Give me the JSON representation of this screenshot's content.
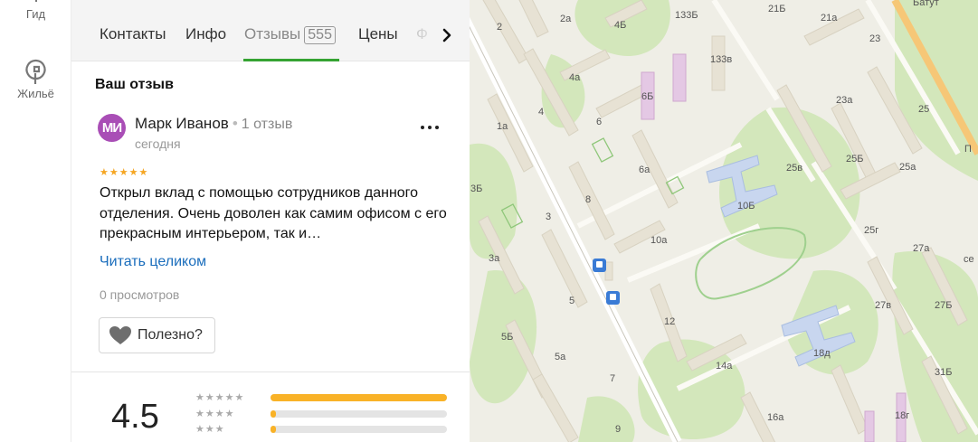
{
  "rail": {
    "items": [
      {
        "label": "Гид",
        "icon": "guide-icon"
      },
      {
        "label": "Жильё",
        "icon": "housing-icon"
      }
    ]
  },
  "tabs": [
    {
      "label": "Контакты"
    },
    {
      "label": "Инфо"
    },
    {
      "label": "Отзывы",
      "badge": "555",
      "active": true
    },
    {
      "label": "Цены"
    },
    {
      "label": "Ф"
    }
  ],
  "review_section": {
    "heading": "Ваш отзыв"
  },
  "review": {
    "avatar_initials": "МИ",
    "author": "Марк Иванов",
    "author_separator": "•",
    "author_reviews": "1 отзыв",
    "date": "сегодня",
    "stars": "★★★★★",
    "text": "Открыл вклад с помощью сотрудников данного отделения. Очень доволен как самим офисом с его прекрасным интерьером, так и…",
    "read_more": "Читать целиком",
    "views": "0 просмотров",
    "useful_label": "Полезно?"
  },
  "summary": {
    "rating": "4.5",
    "distribution": [
      {
        "stars": "★★★★★",
        "fraction": 1.0
      },
      {
        "stars": "★★★★",
        "fraction": 0.03
      },
      {
        "stars": "★★★",
        "fraction": 0.03
      }
    ]
  },
  "map": {
    "labels": [
      "2",
      "2а",
      "4Б",
      "133Б",
      "21Б",
      "21а",
      "23",
      "Батут",
      "133в",
      "4а",
      "6Б",
      "1а",
      "4",
      "23а",
      "25",
      "П",
      "6",
      "25в",
      "25Б",
      "25а",
      "3Б",
      "6а",
      "8",
      "10Б",
      "3",
      "10а",
      "25г",
      "27а",
      "се",
      "3а",
      "5",
      "12",
      "27в",
      "27Б",
      "5Б",
      "18д",
      "5а",
      "14а",
      "31Б",
      "7",
      "16а",
      "18г",
      "9"
    ],
    "colors": {
      "background": "#efeee6",
      "green": "#cfe6b4",
      "road": "#ffffff",
      "highway": "#f6c777",
      "building": "#e7e2d4",
      "purple": "#e4c8e4",
      "blue": "#c8d6ef"
    }
  },
  "colors": {
    "accent_green": "#35a332",
    "link_blue": "#1a6dbc",
    "star_yellow": "#f5a623",
    "bar_yellow": "#f9b227",
    "avatar_purple": "#a94eb6"
  }
}
